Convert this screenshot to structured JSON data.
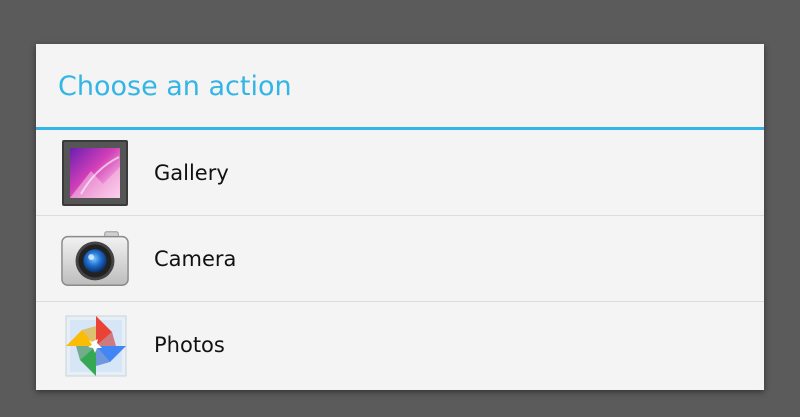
{
  "dialog": {
    "title": "Choose an action",
    "items": [
      {
        "label": "Gallery",
        "icon": "gallery-icon"
      },
      {
        "label": "Camera",
        "icon": "camera-icon"
      },
      {
        "label": "Photos",
        "icon": "photos-pinwheel-icon"
      }
    ]
  },
  "colors": {
    "accent": "#33b5e5",
    "scrim": "#5b5b5b",
    "dialog_bg": "#f4f4f4"
  }
}
